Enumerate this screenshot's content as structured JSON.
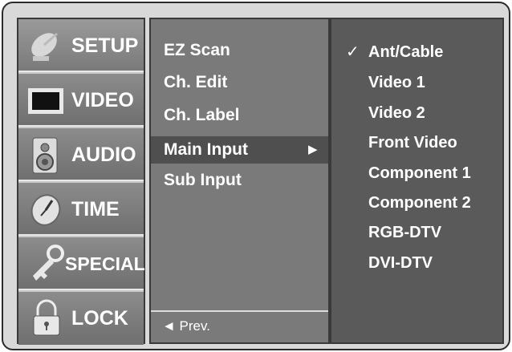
{
  "categories": [
    {
      "label": "SETUP",
      "icon": "satellite-dish-icon"
    },
    {
      "label": "VIDEO",
      "icon": "tv-screen-icon"
    },
    {
      "label": "AUDIO",
      "icon": "speaker-icon"
    },
    {
      "label": "TIME",
      "icon": "clock-icon"
    },
    {
      "label": "SPECIAL",
      "icon": "key-icon"
    },
    {
      "label": "LOCK",
      "icon": "padlock-icon"
    }
  ],
  "submenu": {
    "items": [
      "EZ Scan",
      "Ch. Edit",
      "Ch. Label",
      "Main Input",
      "Sub Input"
    ],
    "selected": "Main Input",
    "arrow": "▶",
    "prev_label": "◄ Prev."
  },
  "options": {
    "items": [
      "Ant/Cable",
      "Video 1",
      "Video 2",
      "Front Video",
      "Component 1",
      "Component 2",
      "RGB-DTV",
      "DVI-DTV"
    ],
    "checked": "Ant/Cable",
    "check_mark": "✓"
  }
}
